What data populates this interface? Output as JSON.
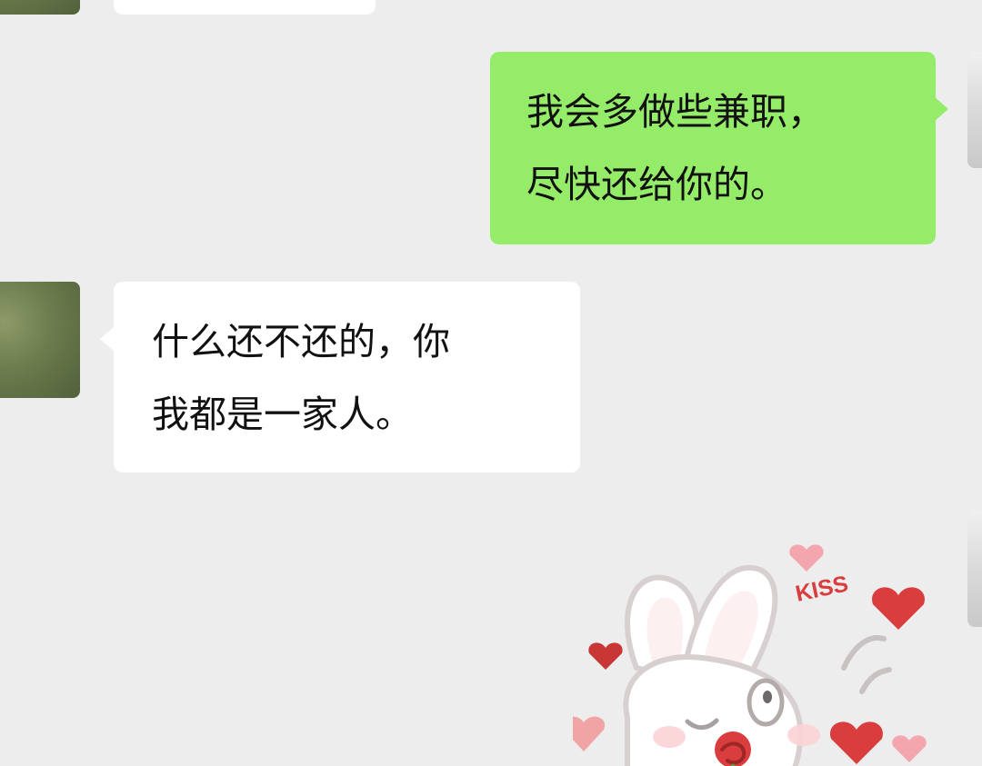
{
  "chat": {
    "messages": [
      {
        "side": "out",
        "lines": [
          "我会多做些兼职，",
          "尽快还给你的。"
        ]
      },
      {
        "side": "in",
        "lines": [
          "什么还不还的，你",
          "我都是一家人。"
        ]
      }
    ],
    "sticker": {
      "text": "KISS",
      "icon": "bunny-kiss-sticker"
    }
  },
  "colors": {
    "background": "#ededed",
    "incoming_bubble": "#ffffff",
    "outgoing_bubble": "#95ec69",
    "text": "#111111",
    "heart": "#d93d3d"
  }
}
